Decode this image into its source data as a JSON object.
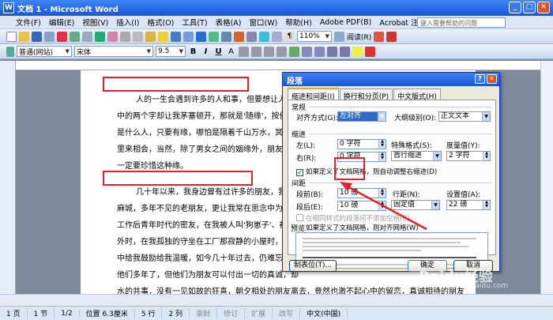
{
  "window": {
    "title": "文档 1 - Microsoft Word"
  },
  "menu": {
    "items": [
      "文件(F)",
      "编辑(E)",
      "视图(V)",
      "插入(I)",
      "格式(O)",
      "工具(T)",
      "表格(A)",
      "窗口(W)",
      "帮助(H)",
      "Adobe PDF(B)",
      "Acrobat 注释(C)"
    ],
    "help_placeholder": "键入需要帮助的问题"
  },
  "toolbar": {
    "zoom": "110%",
    "read_mode": "阅读(R)"
  },
  "format_bar": {
    "style": "普通(网站)",
    "font": "宋体",
    "size": "9.5"
  },
  "document": {
    "lines": [
      "人的一生会遇到许多的人和事，但要想让人成为",
      "中的两个字却让我茅塞顿开，那就是'随缘'，按佛经",
      "是什么人，只要有缘，哪怕是隔着千山万水，冥冥中",
      "里来相会，当然，除了男女之间的姻缘外，朋友之间",
      "一定要珍惜这种缘。",
      "几十年以来，我身边曾有过许多的朋友，我和他",
      "麻城，多年不见的老朋友，更让我常在思念中为他们",
      "工作后青年时代的密友，在我被人叫'狗崽子'、被人",
      "外时，在我孤独的守坐在工厂那寂静的小屋时，是她",
      "中给我鼓励给我温暖，如今几十年过去，仍难忘少女",
      "他们多年了，但他们为朋友可以付出一切的真诚，却",
      "水的共事，没有一见如故的狂喜，朝夕相处的朋友离去，竟然也激不起心中的留恋，真诚相待的朋友"
    ]
  },
  "dialog": {
    "title": "段落",
    "tabs": [
      "缩进和间距(I)",
      "换行和分页(P)",
      "中文版式(H)"
    ],
    "section_general": "常规",
    "align_label": "对齐方式(G):",
    "align_value": "左对齐",
    "outline_label": "大纲级别(O):",
    "outline_value": "正文文本",
    "section_indent": "缩进",
    "left_label": "左(L):",
    "left_value": "0 字符",
    "right_label": "右(R):",
    "right_value": "0 字符",
    "special_label": "特殊格式(S):",
    "special_value": "首行缩进",
    "amount_label": "度量值(Y):",
    "amount_value": "2 字符",
    "grid_indent_check": "如果定义了文档网格，则自动调整右缩进(D)",
    "section_spacing": "间距",
    "before_label": "段前(B):",
    "before_value": "10 磅",
    "after_label": "段后(E):",
    "after_value": "10 磅",
    "linespacing_label": "行距(N):",
    "linespacing_value": "固定值",
    "setvalue_label": "设置值(A):",
    "setvalue_value": "22 磅",
    "no_space_check": "在相同样式的段落间不添加空格(C)",
    "snap_grid_check": "如果定义了文档网格，则对齐网格(W)",
    "section_preview": "预览",
    "tabs_button": "制表位(T)...",
    "ok_button": "确定",
    "cancel_button": "取消"
  },
  "status": {
    "page": "1 页",
    "section": "1 节",
    "pages": "1/2",
    "position": "位置 6.3厘米",
    "line": "5 行",
    "column": "2 列",
    "rec": "录制",
    "trk": "修订",
    "ext": "扩展",
    "ovr": "改写",
    "lang": "中文(中国)"
  },
  "watermark": {
    "brand": "Baidu经验",
    "url": "jingyan.baidu.com"
  }
}
